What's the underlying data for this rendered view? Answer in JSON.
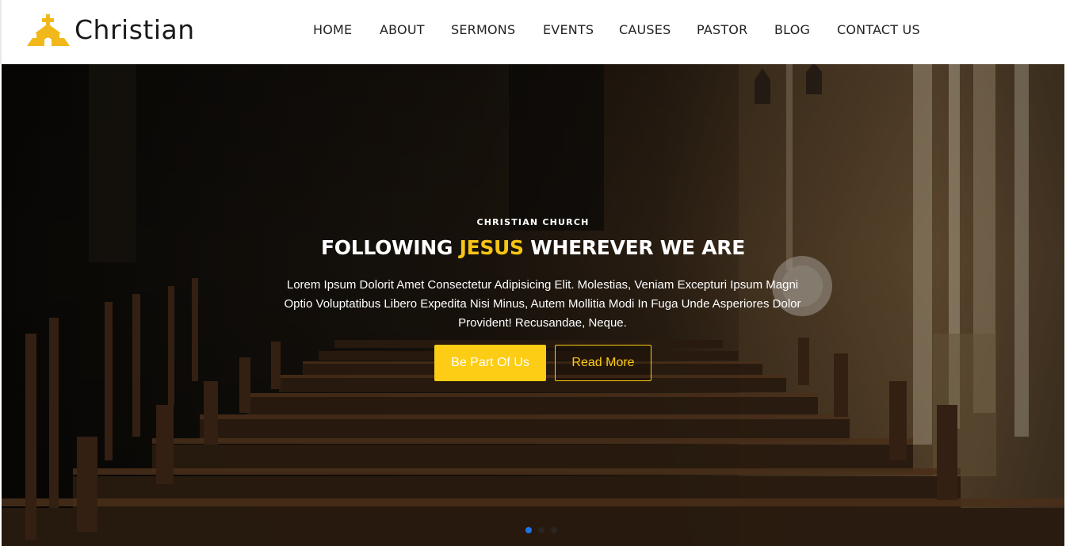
{
  "brand": {
    "name": "Christian",
    "icon": "church-icon",
    "accent": "#f0b81a"
  },
  "nav": {
    "items": [
      "HOME",
      "ABOUT",
      "SERMONS",
      "EVENTS",
      "CAUSES",
      "PASTOR",
      "BLOG",
      "CONTACT US"
    ]
  },
  "hero": {
    "kicker": "CHRISTIAN CHURCH",
    "headline_before": "FOLLOWING ",
    "headline_accent": "JESUS",
    "headline_after": " WHEREVER WE ARE",
    "description": "Lorem Ipsum Dolorit Amet Consectetur Adipisicing Elit. Molestias, Veniam Excepturi Ipsum Magni Optio Voluptatibus Libero Expedita Nisi Minus, Autem Mollitia Modi In Fuga Unde Asperiores Dolor Provident! Recusandae, Neque.",
    "primary_button": "Be Part Of Us",
    "secondary_button": "Read More",
    "accent_color": "#fdcc14",
    "slide_count": 3,
    "active_slide": 1
  }
}
